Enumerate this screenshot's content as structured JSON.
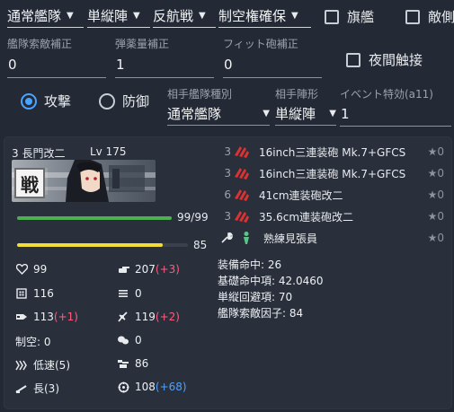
{
  "top": {
    "fleet_type": "通常艦隊",
    "formation": "単縦陣",
    "engagement": "反航戦",
    "air_state": "制空権確保",
    "flagship_label": "旗艦",
    "enemy_flagship_label": "敵側"
  },
  "corrections": {
    "recon_label": "艦隊索敵補正",
    "recon_value": "0",
    "ammo_label": "弾薬量補正",
    "ammo_value": "1",
    "fit_label": "フィット砲補正",
    "fit_value": "0",
    "night_contact_label": "夜間触接"
  },
  "mode": {
    "attack_label": "攻撃",
    "defense_label": "防御",
    "selected": "attack"
  },
  "enemy": {
    "fleet_type_label": "相手艦隊種別",
    "fleet_type_value": "通常艦隊",
    "formation_label": "相手陣形",
    "formation_value": "単縦陣",
    "event_label": "イベント特効(a11)",
    "event_value": "1"
  },
  "ship": {
    "slot": "3",
    "name": "長門改二",
    "level": "Lv 175",
    "hp_text": "99/99",
    "hp_ratio": 1.0,
    "morale_text": "85",
    "morale_ratio": 0.85,
    "stats": {
      "hp": "99",
      "armor": "116",
      "evasion": "113",
      "evasion_bonus": "(+1)",
      "air": "制空: 0",
      "speed": "低速(5)",
      "range": "長(3)",
      "firepower": "207",
      "firepower_bonus": "(+3)",
      "torpedo": "0",
      "aa": "119",
      "aa_bonus": "(+2)",
      "asw": "0",
      "los": "86",
      "luck": "108",
      "luck_bonus": "(+68)"
    }
  },
  "equipment": [
    {
      "slot": "3",
      "name": "16inch三連装砲 Mk.7+GFCS",
      "star": "★0",
      "icon": "main-gun-icon"
    },
    {
      "slot": "3",
      "name": "16inch三連装砲 Mk.7+GFCS",
      "star": "★0",
      "icon": "main-gun-icon"
    },
    {
      "slot": "6",
      "name": "41cm連装砲改二",
      "star": "★0",
      "icon": "main-gun-icon"
    },
    {
      "slot": "3",
      "name": "35.6cm連装砲改二",
      "star": "★0",
      "icon": "main-gun-icon"
    },
    {
      "slot": "",
      "name": "熟練見張員",
      "star": "★0",
      "icon": "lookout-icon"
    }
  ],
  "summary": {
    "accuracy": "装備命中: 26",
    "base_hit": "基礎命中項: 42.0460",
    "evasion_term": "単縦回避項: 70",
    "recon_factor": "艦隊索敵因子: 84"
  },
  "colors": {
    "accent": "#4aa3ff",
    "hp_bar": "#4caf50",
    "morale_bar": "#f2dd38",
    "bonus_red": "#ff5b7f",
    "bonus_blue": "#4ea1ff",
    "gun_red": "#e03131"
  }
}
